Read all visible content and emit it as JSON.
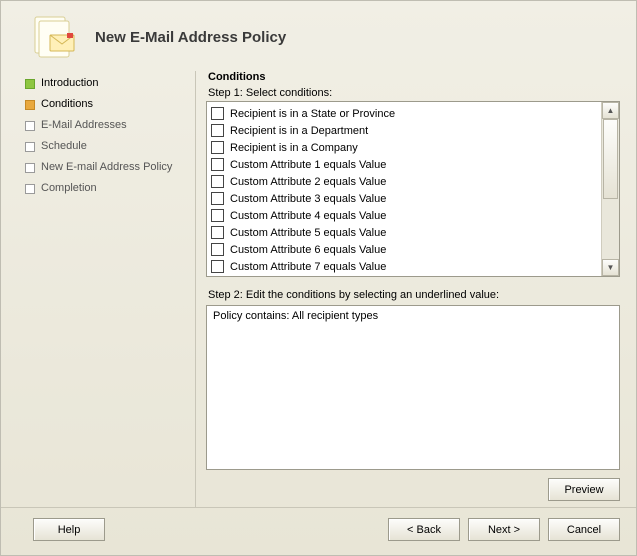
{
  "header": {
    "title": "New E-Mail Address Policy"
  },
  "sidebar": {
    "steps": [
      {
        "label": "Introduction",
        "state": "done"
      },
      {
        "label": "Conditions",
        "state": "current"
      },
      {
        "label": "E-Mail Addresses",
        "state": "pending"
      },
      {
        "label": "Schedule",
        "state": "pending"
      },
      {
        "label": "New E-mail Address Policy",
        "state": "pending"
      },
      {
        "label": "Completion",
        "state": "pending"
      }
    ]
  },
  "content": {
    "heading": "Conditions",
    "step1_label": "Step 1: Select conditions:",
    "conditions": [
      "Recipient is in a State or Province",
      "Recipient is in a Department",
      "Recipient is in a Company",
      "Custom Attribute 1 equals Value",
      "Custom Attribute 2 equals Value",
      "Custom Attribute 3 equals Value",
      "Custom Attribute 4 equals Value",
      "Custom Attribute 5 equals Value",
      "Custom Attribute 6 equals Value",
      "Custom Attribute 7 equals Value"
    ],
    "step2_label": "Step 2: Edit the conditions by selecting an underlined value:",
    "edit_text": "Policy contains: All recipient types",
    "preview_label": "Preview"
  },
  "footer": {
    "help": "Help",
    "back": "< Back",
    "next": "Next >",
    "cancel": "Cancel"
  }
}
